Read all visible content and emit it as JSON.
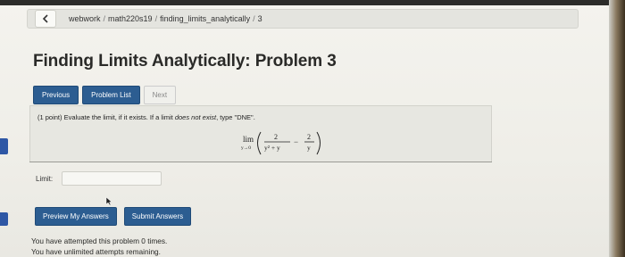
{
  "breadcrumb": {
    "items": [
      "webwork",
      "math220s19",
      "finding_limits_analytically",
      "3"
    ],
    "separator": "/"
  },
  "page_title": "Finding Limits Analytically: Problem 3",
  "nav": {
    "previous": "Previous",
    "problem_list": "Problem List",
    "next": "Next"
  },
  "problem": {
    "points": "(1 point)",
    "instruction_start": "Evaluate the limit, if it exists. If a limit ",
    "instruction_italic": "does not exist",
    "instruction_end": ", type \"DNE\".",
    "math": {
      "lim": "lim",
      "sub": "y→0",
      "frac1_num": "2",
      "frac1_den": "y² + y",
      "minus": "−",
      "frac2_num": "2",
      "frac2_den": "y"
    }
  },
  "answer": {
    "label": "Limit:",
    "value": "",
    "placeholder": ""
  },
  "actions": {
    "preview": "Preview My Answers",
    "submit": "Submit Answers"
  },
  "status": {
    "line1": "You have attempted this problem 0 times.",
    "line2": "You have unlimited attempts remaining."
  },
  "colors": {
    "button_blue": "#2c5d91",
    "marker_blue": "#2e57a5",
    "background": "#f1f0eb"
  }
}
